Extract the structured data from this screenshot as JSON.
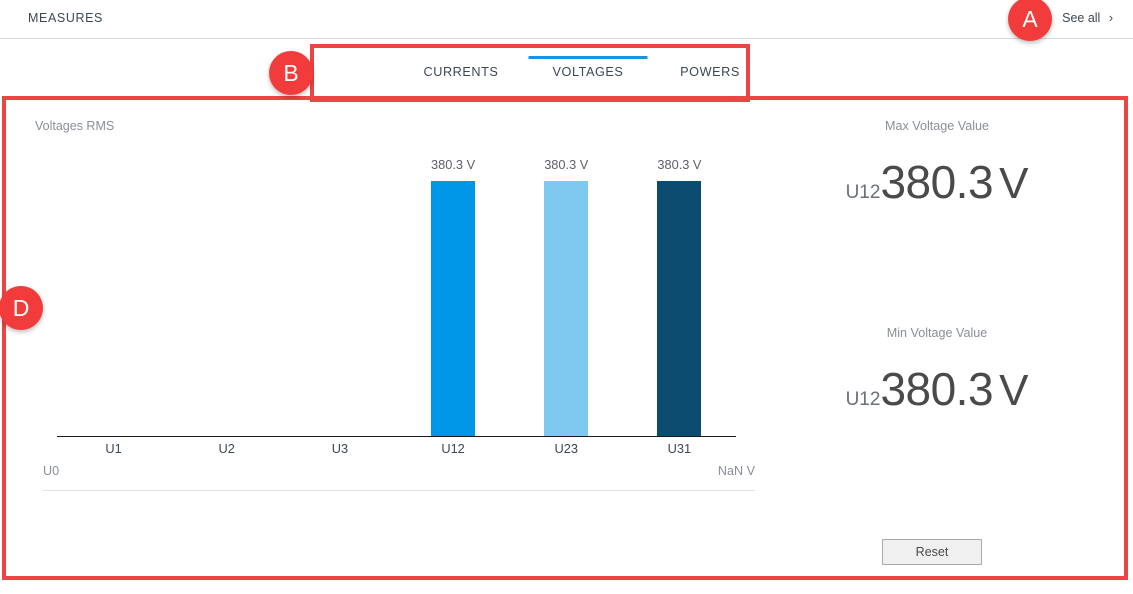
{
  "header": {
    "title": "MEASURES",
    "see_all_label": "See all",
    "see_all_chevron": "›"
  },
  "tabs": [
    {
      "label": "CURRENTS",
      "active": false
    },
    {
      "label": "VOLTAGES",
      "active": true
    },
    {
      "label": "POWERS",
      "active": false
    }
  ],
  "chart_data": {
    "type": "bar",
    "title": "Voltages RMS",
    "xlabel": "",
    "ylabel": "",
    "categories": [
      "U1",
      "U2",
      "U3",
      "U12",
      "U23",
      "U31"
    ],
    "values": [
      null,
      null,
      null,
      380.3,
      380.3,
      380.3
    ],
    "value_labels": [
      "",
      "",
      "",
      "380.3 V",
      "380.3 V",
      "380.3 V"
    ],
    "unit": "V",
    "bar_colors": [
      "#0096e8",
      "#7fc8f0",
      "#0b4c70"
    ],
    "colored_bar_indices": [
      3,
      4,
      5
    ],
    "grid": false,
    "legend": "none",
    "axis_footer_left": "U0",
    "axis_footer_right": "NaN V"
  },
  "readouts": [
    {
      "label": "Max Voltage Value",
      "phase": "U12",
      "number": "380.3",
      "unit": "V"
    },
    {
      "label": "Min Voltage Value",
      "phase": "U12",
      "number": "380.3",
      "unit": "V"
    }
  ],
  "actions": {
    "reset_label": "Reset"
  },
  "annotations": [
    {
      "id": "A",
      "label": "A"
    },
    {
      "id": "B",
      "label": "B"
    },
    {
      "id": "D",
      "label": "D"
    }
  ],
  "colors": {
    "accent_blue": "#1b94d8",
    "annotation_red": "#f23b3b",
    "text_dark": "#3d4756",
    "text_muted": "#8a8f96"
  }
}
